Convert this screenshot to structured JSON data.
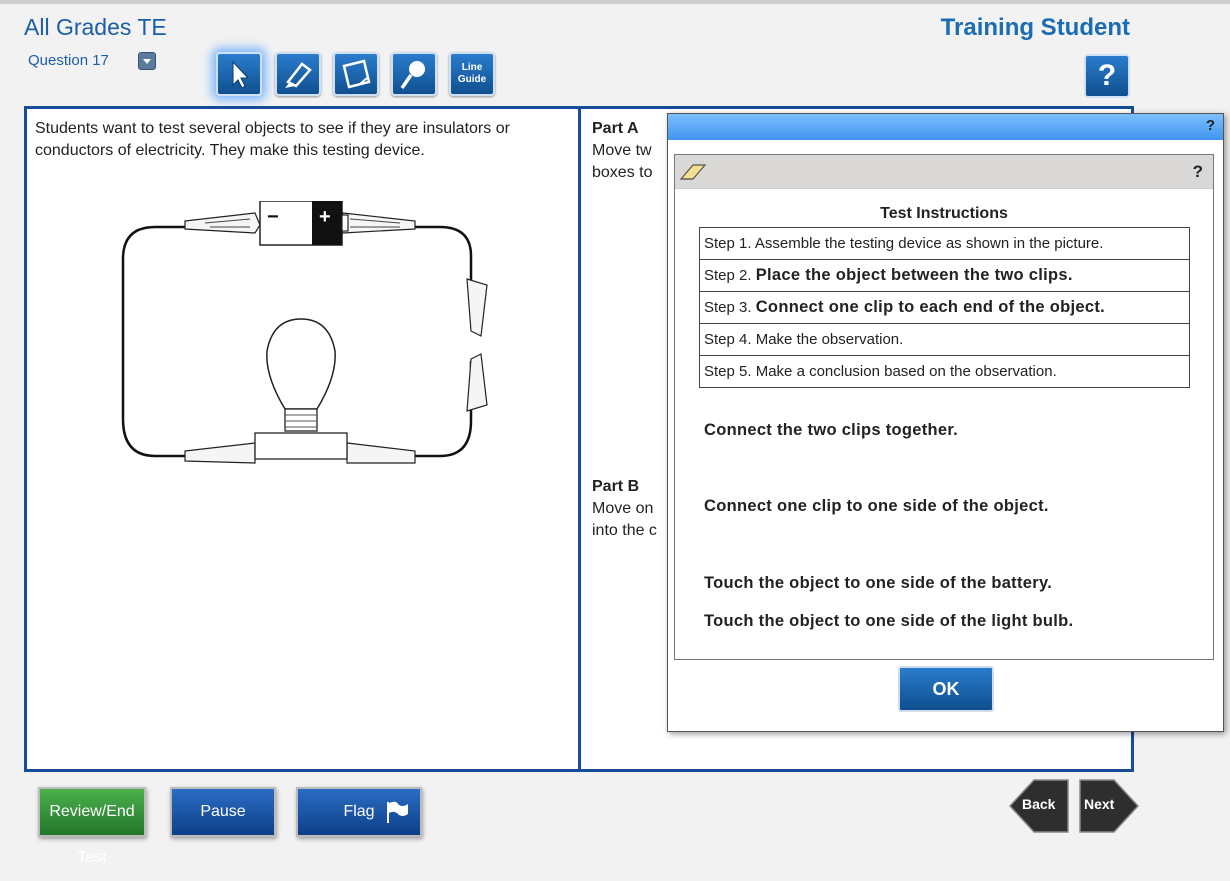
{
  "header": {
    "app_title": "All Grades TE",
    "student_name": "Training Student",
    "question_label": "Question 17"
  },
  "toolbar": {
    "tools": [
      {
        "name": "pointer-icon",
        "active": true
      },
      {
        "name": "highlighter-icon",
        "active": false
      },
      {
        "name": "notepad-icon",
        "active": false
      },
      {
        "name": "magnifier-icon",
        "active": false
      }
    ],
    "line_guide_label_1": "Line",
    "line_guide_label_2": "Guide",
    "help_label": "?"
  },
  "left_panel": {
    "prompt": "Students want to test several objects to see if they are insulators or conductors of electricity. They make this testing device.",
    "battery_minus": "−",
    "battery_plus": "+"
  },
  "right_panel": {
    "partA_title": "Part A",
    "partA_text_1": "Move tw",
    "partA_text_2": "boxes to",
    "partB_title": "Part B",
    "partB_text_1": "Move on",
    "partB_text_2": "into the c"
  },
  "dialog": {
    "help_label": "?",
    "inner_help_label": "?",
    "instructions_title": "Test Instructions",
    "steps": [
      {
        "prefix": "Step 1.",
        "text": "Assemble the testing device as shown in the picture.",
        "bold": false
      },
      {
        "prefix": "Step 2.",
        "text": "Place the object between the two clips.",
        "bold": true
      },
      {
        "prefix": "Step 3.",
        "text": "Connect one clip to each end of the object.",
        "bold": true
      },
      {
        "prefix": "Step 4.",
        "text": "Make the observation.",
        "bold": false
      },
      {
        "prefix": "Step 5.",
        "text": "Make a conclusion based on the observation.",
        "bold": false
      }
    ],
    "options": [
      "Connect the two clips together.",
      "Connect one clip to one side of the object.",
      "Touch the object to one side of the battery.",
      "Touch the object to one side of the light bulb."
    ],
    "ok_label": "OK"
  },
  "footer": {
    "review_label": "Review/End Test",
    "pause_label": "Pause",
    "flag_label": "Flag",
    "back_label": "Back",
    "next_label": "Next"
  },
  "colors": {
    "brand_blue": "#1a5ea8",
    "border_blue": "#154d9a",
    "review_green": "#22762a"
  }
}
